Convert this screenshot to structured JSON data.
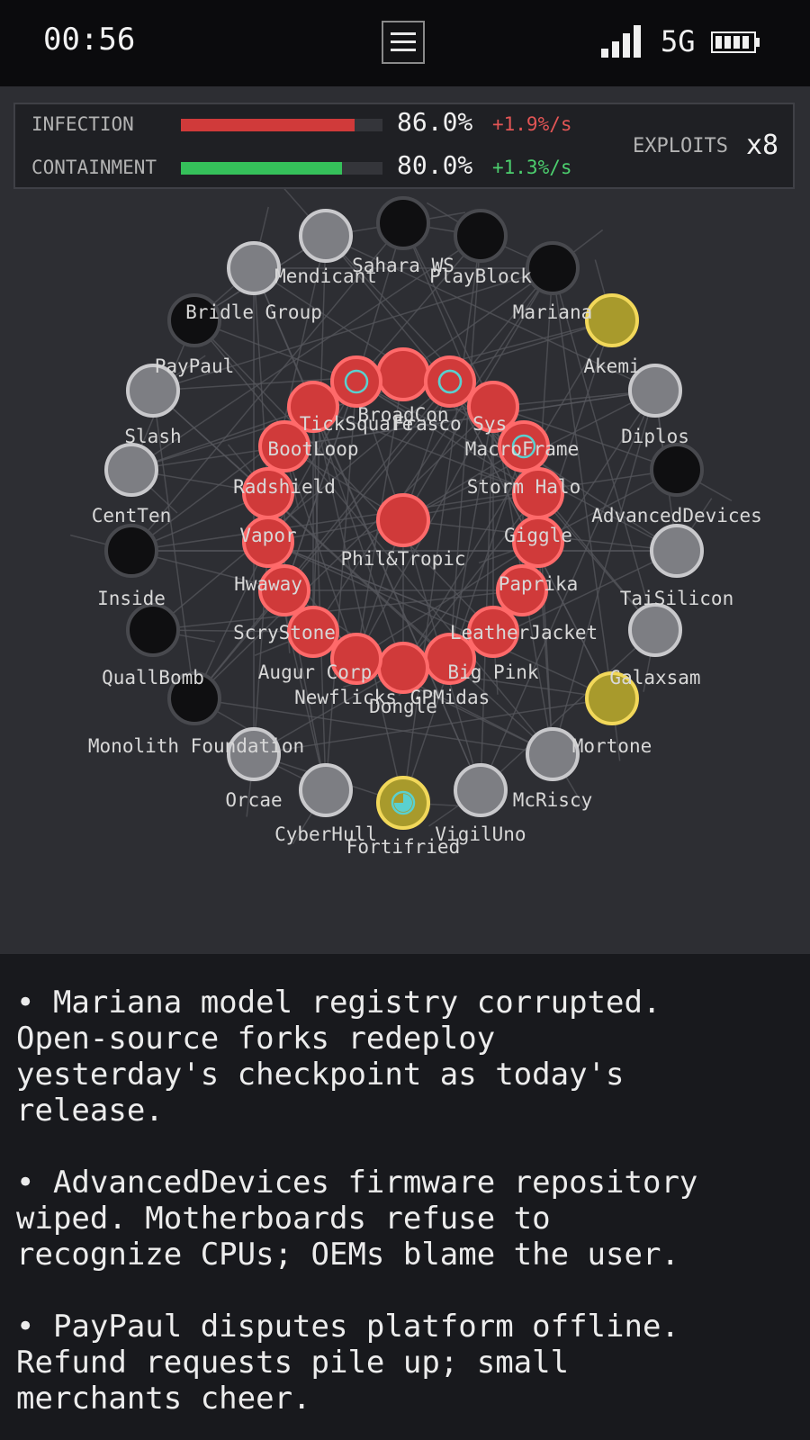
{
  "status_bar": {
    "time": "00:56",
    "network": "5G",
    "signal_icon": "signal-bars-icon",
    "battery_icon": "battery-icon",
    "menu_icon": "hamburger-menu-icon"
  },
  "stats": {
    "infection": {
      "label": "INFECTION",
      "value": "86.0%",
      "rate": "+1.9%/s",
      "level": 0.86,
      "color": "#d03a3a"
    },
    "containment": {
      "label": "CONTAINMENT",
      "value": "80.0%",
      "rate": "+1.3%/s",
      "level": 0.8,
      "color": "#35c05a"
    },
    "exploits_label": "EXPLOITS",
    "exploits_count": "x8"
  },
  "colors": {
    "infected": "#d03a3a",
    "infected_ring": "#ff6a6a",
    "compromised": "#a89a2c",
    "compromised_ring": "#f2d85a",
    "clean": "#7d7e83",
    "clean_ring": "#c9c9cc",
    "dark": "#0f0f11",
    "dark_ring": "#48494e",
    "exploit_marker": "#5ad0cf"
  },
  "nodes": [
    {
      "name": "Phil&Tropic",
      "state": "infected"
    },
    {
      "name": "BroadCon",
      "state": "infected"
    },
    {
      "name": "Frasco Sys",
      "state": "infected",
      "exploit": true
    },
    {
      "name": "MacroFrame",
      "state": "infected"
    },
    {
      "name": "Storm Halo",
      "state": "infected",
      "exploit": true
    },
    {
      "name": "Giggle",
      "state": "infected"
    },
    {
      "name": "Paprika",
      "state": "infected"
    },
    {
      "name": "LeatherJacket",
      "state": "infected"
    },
    {
      "name": "Big Pink",
      "state": "infected"
    },
    {
      "name": "GPMidas",
      "state": "infected"
    },
    {
      "name": "Dongle",
      "state": "infected"
    },
    {
      "name": "Newflicks",
      "state": "infected"
    },
    {
      "name": "Augur Corp",
      "state": "infected"
    },
    {
      "name": "ScryStone",
      "state": "infected"
    },
    {
      "name": "Hwaway",
      "state": "infected"
    },
    {
      "name": "Vapor",
      "state": "infected"
    },
    {
      "name": "Radshield",
      "state": "infected"
    },
    {
      "name": "BootLoop",
      "state": "infected"
    },
    {
      "name": "TickSquare",
      "state": "infected",
      "exploit": true
    },
    {
      "name": "Sahara WS",
      "state": "infected",
      "exploit": true
    },
    {
      "name": "PlayBlock",
      "state": "dark"
    },
    {
      "name": "Mariana",
      "state": "dark"
    },
    {
      "name": "Akemi",
      "state": "compromised"
    },
    {
      "name": "Diplos",
      "state": "clean"
    },
    {
      "name": "AdvancedDevices",
      "state": "dark"
    },
    {
      "name": "TaiSilicon",
      "state": "clean"
    },
    {
      "name": "Galaxsam",
      "state": "clean"
    },
    {
      "name": "Mortone",
      "state": "compromised"
    },
    {
      "name": "McRiscy",
      "state": "clean"
    },
    {
      "name": "VigilUno",
      "state": "clean"
    },
    {
      "name": "Fortifried",
      "state": "compromised",
      "progress": 0.75
    },
    {
      "name": "CyberHull",
      "state": "clean"
    },
    {
      "name": "Orcae",
      "state": "clean"
    },
    {
      "name": "Monolith Foundation",
      "state": "dark"
    },
    {
      "name": "QuallBomb",
      "state": "dark"
    },
    {
      "name": "Inside",
      "state": "dark"
    },
    {
      "name": "CentTen",
      "state": "clean"
    },
    {
      "name": "Slash",
      "state": "clean"
    },
    {
      "name": "PayPaul",
      "state": "clean"
    },
    {
      "name": "Bridle Group",
      "state": "dark"
    },
    {
      "name": "Mendicant",
      "state": "clean"
    },
    {
      "name": "Sahara WS (outer)",
      "state": "clean"
    },
    {
      "name": "outer-dark-1",
      "state": "dark"
    },
    {
      "name": "outer-dark-2",
      "state": "dark"
    }
  ],
  "node_labels": {
    "Phil&Tropic": "Phil&Tropic",
    "BroadCon": "BroadCon",
    "Frasco Sys": "Frasco Sys",
    "MacroFrame": "MacroFrame",
    "Storm Halo": "Storm Halo",
    "Giggle": "Giggle",
    "Paprika": "Paprika",
    "LeatherJacket": "LeatherJacket",
    "Big Pink": "Big Pink",
    "GPMidas": "GPMidas",
    "Dongle": "Dongle",
    "Newflicks": "Newflicks",
    "Augur Corp": "Augur Corp",
    "ScryStone": "ScryStone",
    "Hwaway": "Hwaway",
    "Vapor": "Vapor",
    "Radshield": "Radshield",
    "BootLoop": "BootLoop",
    "TickSquare": "TickSquare",
    "Sahara WS": "Sahara WS",
    "PlayBlock": "PlayBlock",
    "Mariana": "Mariana",
    "Akemi": "Akemi",
    "Diplos": "Diplos",
    "AdvancedDevices": "AdvancedDevices",
    "TaiSilicon": "TaiSilicon",
    "Galaxsam": "Galaxsam",
    "Mortone": "Mortone",
    "McRiscy": "McRiscy",
    "VigilUno": "VigilUno",
    "Fortifried": "Fortifried",
    "CyberHull": "CyberHull",
    "Orcae": "Orcae",
    "Monolith Foundation": "Monolith Foundation",
    "QuallBomb": "QuallBomb",
    "Inside": "Inside",
    "CentTen": "CentTen",
    "Slash": "Slash",
    "PayPaul": "PayPaul",
    "Bridle Group": "Bridle Group",
    "Mendicant": "Mendicant"
  },
  "news": [
    "• Mariana model registry corrupted.\nOpen-source forks redeploy\nyesterday's checkpoint as today's\nrelease.",
    "• AdvancedDevices firmware repository\nwiped. Motherboards refuse to\nrecognize CPUs; OEMs blame the user.",
    "• PayPaul disputes platform offline.\nRefund requests pile up; small\nmerchants cheer."
  ]
}
